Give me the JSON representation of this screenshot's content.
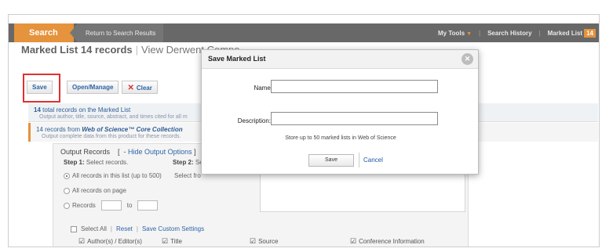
{
  "header": {
    "search_tab": "Search",
    "return_link": "Return to Search Results",
    "my_tools": "My Tools",
    "search_history": "Search History",
    "marked_list": "Marked List",
    "marked_count": "14",
    "accent_color": "#e38a2c"
  },
  "page": {
    "title": "Marked List 14 records",
    "title_secondary": "View Derwent Compo"
  },
  "toolbar": {
    "save_label": "Save",
    "open_manage_label": "Open/Manage",
    "clear_label": "Clear"
  },
  "records": {
    "row1_count": "14",
    "row1_text": "total records on the Marked List",
    "row1_desc": "Output author, title, source, abstract, and times cited for all m",
    "row2_prefix": "14 records from",
    "row2_collection": "Web of Science™ Core Collection",
    "row2_desc": "Output complete data from this product for these records."
  },
  "output": {
    "title": "Output Records",
    "bracket_open": "[",
    "hide_link": "- Hide Output Options",
    "bracket_close": "]",
    "step1_label": "Step 1:",
    "step1_text": "Select records.",
    "step2_label": "Step 2:",
    "step2_text": "Se",
    "select_from": "Select fro",
    "radio_all_list": "All records in this list (up to 500)",
    "radio_all_page": "All records on page",
    "radio_records": "Records",
    "radio_to": "to",
    "select_all": "Select All",
    "reset": "Reset",
    "save_custom": "Save Custom Settings",
    "field_author": "Author(s) / Editor(s)",
    "field_title": "Title",
    "field_source": "Source",
    "field_conference": "Conference Information"
  },
  "modal": {
    "title": "Save Marked List",
    "name_label": "Name:",
    "description_label": "Description:",
    "name_value": "",
    "description_value": "",
    "note": "Store up to 50 marked lists in Web of Science",
    "save_label": "Save",
    "cancel_label": "Cancel",
    "close_icon": "close-icon"
  }
}
